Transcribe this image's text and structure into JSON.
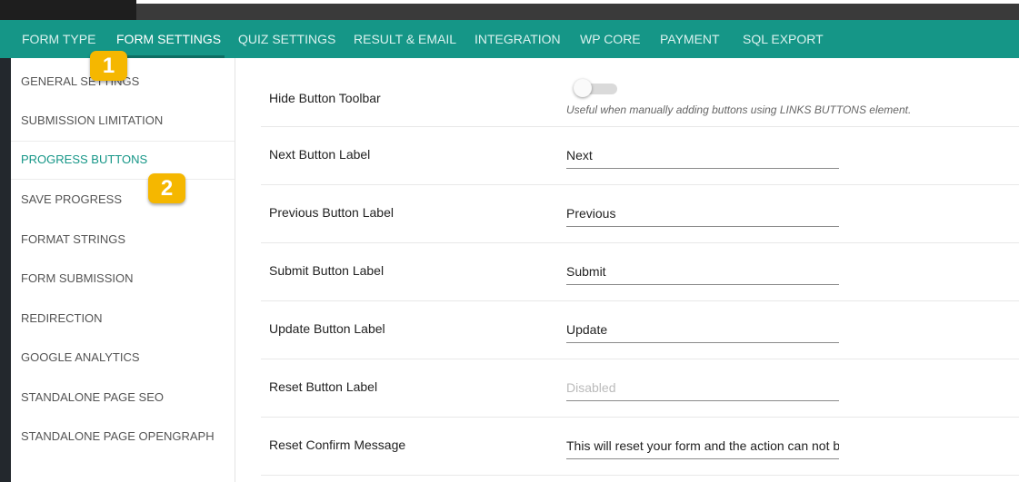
{
  "colors": {
    "accent": "#159687",
    "highlight": "#f4d71f",
    "badge": "#f5b700"
  },
  "topnav": {
    "tabs": [
      {
        "label": "FORM TYPE"
      },
      {
        "label": "FORM SETTINGS",
        "active": true
      },
      {
        "label": "QUIZ SETTINGS"
      },
      {
        "label": "RESULT & EMAIL"
      },
      {
        "label": "INTEGRATION"
      },
      {
        "label": "WP CORE"
      },
      {
        "label": "PAYMENT"
      },
      {
        "label": "SQL EXPORT"
      }
    ]
  },
  "sidebar": {
    "items": [
      {
        "label": "GENERAL SETTINGS"
      },
      {
        "label": "SUBMISSION LIMITATION"
      },
      {
        "label": "PROGRESS BUTTONS",
        "active": true
      },
      {
        "label": "SAVE PROGRESS"
      },
      {
        "label": "FORMAT STRINGS"
      },
      {
        "label": "FORM SUBMISSION"
      },
      {
        "label": "REDIRECTION"
      },
      {
        "label": "GOOGLE ANALYTICS"
      },
      {
        "label": "STANDALONE PAGE SEO"
      },
      {
        "label": "STANDALONE PAGE OPENGRAPH"
      }
    ]
  },
  "settings": {
    "hide_toolbar": {
      "label": "Hide Button Toolbar",
      "enabled": false,
      "hint": "Useful when manually adding buttons using LINKS BUTTONS element."
    },
    "next": {
      "label": "Next Button Label",
      "value": "Next"
    },
    "previous": {
      "label": "Previous Button Label",
      "value": "Previous"
    },
    "submit": {
      "label": "Submit Button Label",
      "value": "Submit"
    },
    "update": {
      "label": "Update Button Label",
      "value": "Update"
    },
    "reset": {
      "label": "Reset Button Label",
      "value": "",
      "placeholder": "Disabled"
    },
    "reset_confirm": {
      "label": "Reset Confirm Message",
      "value": "This will reset your form and the action can not b"
    }
  },
  "badges": {
    "one": "1",
    "two": "2"
  }
}
